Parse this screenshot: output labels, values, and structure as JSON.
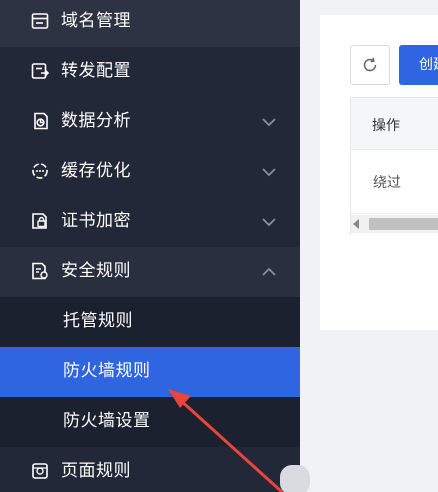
{
  "sidebar": {
    "items": [
      {
        "label": "域名管理",
        "icon": "domain-icon"
      },
      {
        "label": "转发配置",
        "icon": "forward-config-icon"
      },
      {
        "label": "数据分析",
        "icon": "data-analysis-icon",
        "chevron": "down"
      },
      {
        "label": "缓存优化",
        "icon": "cache-icon",
        "chevron": "down"
      },
      {
        "label": "证书加密",
        "icon": "certificate-icon",
        "chevron": "down"
      },
      {
        "label": "安全规则",
        "icon": "security-rules-icon",
        "chevron": "up"
      },
      {
        "label": "页面规则",
        "icon": "page-rules-icon"
      }
    ],
    "sub_items": [
      {
        "label": "托管规则"
      },
      {
        "label": "防火墙规则",
        "active": true
      },
      {
        "label": "防火墙设置"
      }
    ]
  },
  "toolbar": {
    "refresh_icon": "refresh-icon",
    "create_label": "创建"
  },
  "table": {
    "header": "操作",
    "row_value": "绕过"
  },
  "colors": {
    "sidebar_bg": "#222838",
    "active_bg": "#2f65e0",
    "annotation_arrow": "#e8453c"
  }
}
